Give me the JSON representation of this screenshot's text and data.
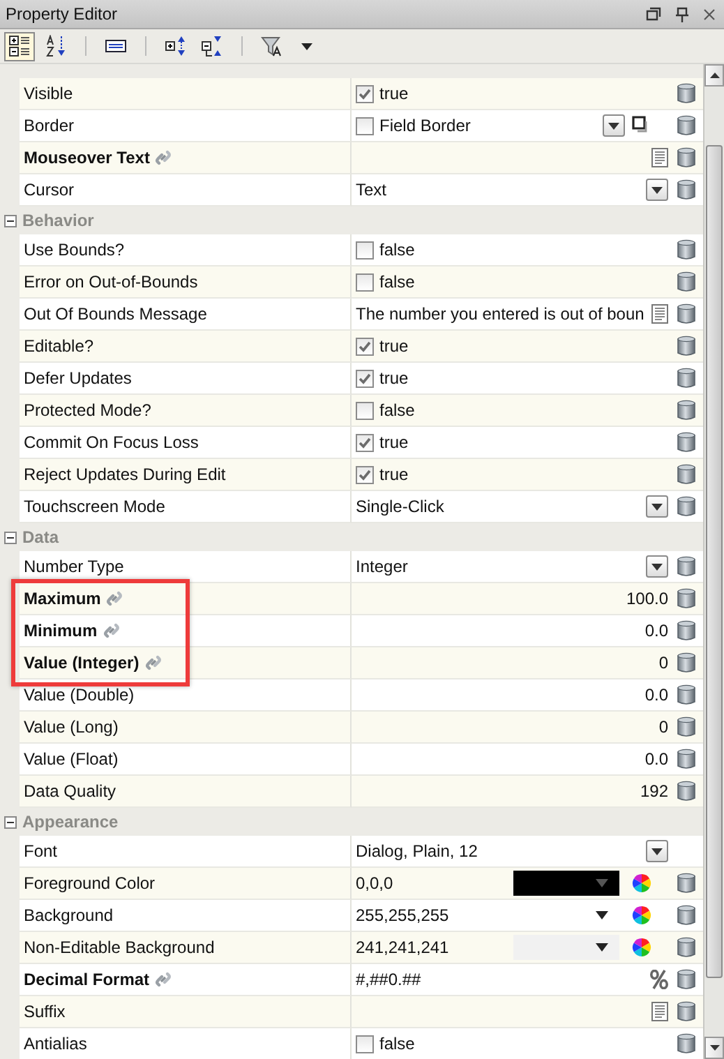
{
  "window": {
    "title": "Property Editor"
  },
  "toolbar": [
    {
      "kind": "categorized",
      "selected": true
    },
    {
      "kind": "alphabetical",
      "selected": false
    },
    {
      "kind": "description",
      "selected": false
    },
    {
      "kind": "expand",
      "selected": false
    },
    {
      "kind": "collapse",
      "selected": false
    },
    {
      "kind": "filter",
      "selected": false
    }
  ],
  "sections": [
    {
      "rows": [
        {
          "name": "Visible",
          "bound": false,
          "kind": "checkbox",
          "checked": true,
          "value": "true",
          "bindable": true
        },
        {
          "name": "Border",
          "bound": false,
          "kind": "border",
          "checked": false,
          "value": "Field Border",
          "bindable": true
        },
        {
          "name": "Mouseover Text",
          "bound": true,
          "kind": "longtext",
          "bindable": true
        },
        {
          "name": "Cursor",
          "bound": false,
          "kind": "dropdown",
          "value": "Text",
          "bindable": true
        }
      ]
    },
    {
      "title": "Behavior",
      "expanded": true,
      "rows": [
        {
          "name": "Use Bounds?",
          "bound": false,
          "kind": "checkbox",
          "checked": false,
          "value": "false",
          "bindable": true
        },
        {
          "name": "Error on Out-of-Bounds",
          "bound": false,
          "kind": "checkbox",
          "checked": false,
          "value": "false",
          "bindable": true
        },
        {
          "name": "Out Of Bounds Message",
          "bound": false,
          "kind": "longtext",
          "value": "The number you entered is out of boun",
          "bindable": true
        },
        {
          "name": "Editable?",
          "bound": false,
          "kind": "checkbox",
          "checked": true,
          "value": "true",
          "bindable": true
        },
        {
          "name": "Defer Updates",
          "bound": false,
          "kind": "checkbox",
          "checked": true,
          "value": "true",
          "bindable": true
        },
        {
          "name": "Protected Mode?",
          "bound": false,
          "kind": "checkbox",
          "checked": false,
          "value": "false",
          "bindable": true
        },
        {
          "name": "Commit On Focus Loss",
          "bound": false,
          "kind": "checkbox",
          "checked": true,
          "value": "true",
          "bindable": true
        },
        {
          "name": "Reject Updates During Edit",
          "bound": false,
          "kind": "checkbox",
          "checked": true,
          "value": "true",
          "bindable": true
        },
        {
          "name": "Touchscreen Mode",
          "bound": false,
          "kind": "dropdown",
          "value": "Single-Click",
          "bindable": true
        }
      ]
    },
    {
      "title": "Data",
      "expanded": true,
      "rows": [
        {
          "name": "Number Type",
          "bound": false,
          "kind": "dropdown",
          "value": "Integer",
          "bindable": true,
          "highlighted": false
        },
        {
          "name": "Maximum",
          "bound": true,
          "kind": "number",
          "value": "100.0",
          "bindable": true,
          "highlighted": true
        },
        {
          "name": "Minimum",
          "bound": true,
          "kind": "number",
          "value": "0.0",
          "bindable": true,
          "highlighted": true
        },
        {
          "name": "Value (Integer)",
          "bound": true,
          "kind": "number",
          "value": "0",
          "bindable": true,
          "highlighted": true
        },
        {
          "name": "Value (Double)",
          "bound": false,
          "kind": "number",
          "value": "0.0",
          "bindable": true,
          "highlighted": false
        },
        {
          "name": "Value (Long)",
          "bound": false,
          "kind": "number",
          "value": "0",
          "bindable": true,
          "highlighted": false
        },
        {
          "name": "Value (Float)",
          "bound": false,
          "kind": "number",
          "value": "0.0",
          "bindable": true,
          "highlighted": false
        },
        {
          "name": "Data Quality",
          "bound": false,
          "kind": "number",
          "value": "192",
          "bindable": true,
          "highlighted": false
        }
      ]
    },
    {
      "title": "Appearance",
      "expanded": true,
      "rows": [
        {
          "name": "Font",
          "bound": false,
          "kind": "font",
          "value": "Dialog, Plain, 12",
          "bindable": false
        },
        {
          "name": "Foreground Color",
          "bound": false,
          "kind": "color",
          "value": "0,0,0",
          "color": "#000000",
          "bindable": true
        },
        {
          "name": "Background",
          "bound": false,
          "kind": "color",
          "value": "255,255,255",
          "color": "#ffffff",
          "bindable": true
        },
        {
          "name": "Non-Editable Background",
          "bound": false,
          "kind": "color",
          "value": "241,241,241",
          "color": "#f1f1f1",
          "bindable": true
        },
        {
          "name": "Decimal Format",
          "bound": true,
          "kind": "format",
          "value": "#,##0.##",
          "bindable": true
        },
        {
          "name": "Suffix",
          "bound": false,
          "kind": "longtext",
          "bindable": true
        },
        {
          "name": "Antialias",
          "bound": false,
          "kind": "checkbox",
          "checked": false,
          "value": "false",
          "bindable": true
        }
      ]
    }
  ]
}
